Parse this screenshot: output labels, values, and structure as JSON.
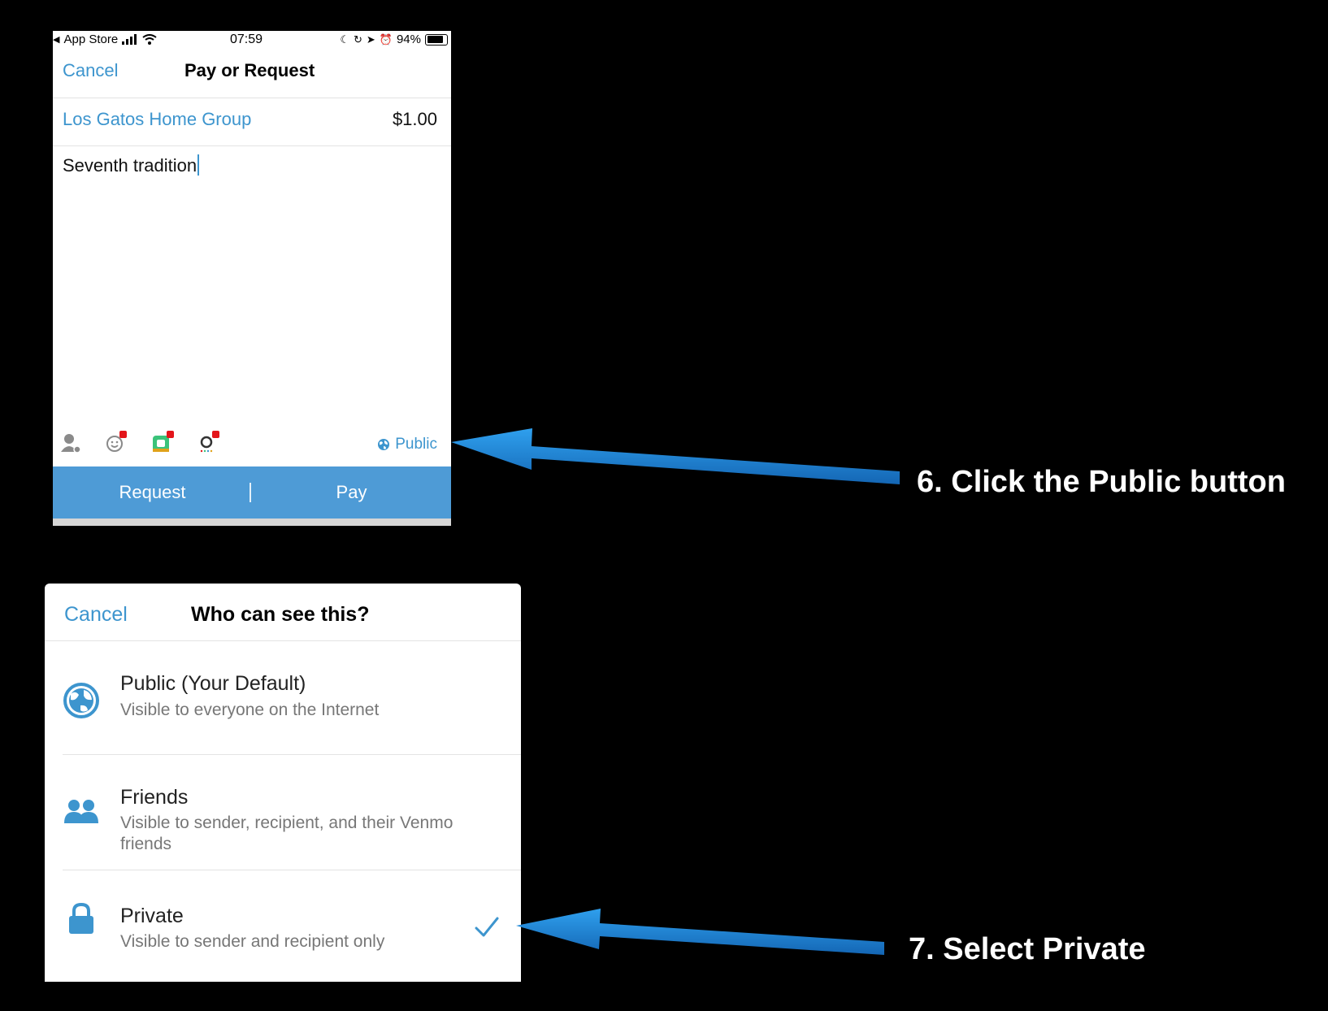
{
  "status_bar": {
    "carrier": "App Store",
    "time": "07:59",
    "battery": "94%",
    "battery_level": 0.94
  },
  "pay_screen": {
    "cancel_label": "Cancel",
    "title": "Pay or Request",
    "recipient": "Los Gatos Home Group",
    "amount": "$1.00",
    "note": "Seventh tradition",
    "privacy_label": "Public",
    "request_label": "Request",
    "pay_label": "Pay",
    "toolbar_icons": [
      "user-tag-icon",
      "emoji-icon",
      "sticker-icon",
      "gif-icon"
    ]
  },
  "privacy_screen": {
    "cancel_label": "Cancel",
    "title": "Who can see this?",
    "options": [
      {
        "icon": "globe-icon",
        "title": "Public (Your Default)",
        "description": "Visible to everyone on the Internet",
        "selected": false
      },
      {
        "icon": "friends-icon",
        "title": "Friends",
        "description": "Visible to sender, recipient, and their Venmo friends",
        "selected": false
      },
      {
        "icon": "lock-icon",
        "title": "Private",
        "description": "Visible to sender and recipient only",
        "selected": true
      }
    ]
  },
  "annotations": {
    "step6": "6. Click the Public button",
    "step7": "7. Select Private"
  },
  "colors": {
    "accent": "#3d95ce",
    "action_bar": "#4e9bd6",
    "arrow": "#1f86d6",
    "badge": "#e3151a"
  }
}
